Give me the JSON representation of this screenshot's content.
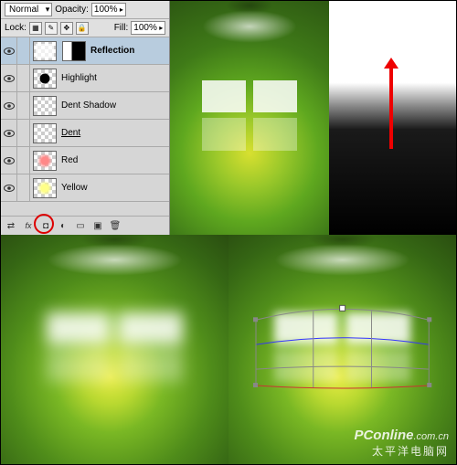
{
  "blend_mode": {
    "value": "Normal"
  },
  "opacity": {
    "label": "Opacity:",
    "value": "100%"
  },
  "fill": {
    "label": "Fill:",
    "value": "100%"
  },
  "lock": {
    "label": "Lock:"
  },
  "layers": [
    {
      "name": "Reflection",
      "selected": true,
      "bold": true,
      "underline": false,
      "mask": true
    },
    {
      "name": "Highlight",
      "selected": false,
      "bold": false,
      "underline": false,
      "mask": false
    },
    {
      "name": "Dent Shadow",
      "selected": false,
      "bold": false,
      "underline": false,
      "mask": false
    },
    {
      "name": "Dent",
      "selected": false,
      "bold": false,
      "underline": true,
      "mask": false
    },
    {
      "name": "Red",
      "selected": false,
      "bold": false,
      "underline": false,
      "mask": false
    },
    {
      "name": "Yellow",
      "selected": false,
      "bold": false,
      "underline": false,
      "mask": false
    }
  ],
  "footer_icons": {
    "link": "chain-icon",
    "fx": "fx",
    "mask": "mask-icon",
    "adjust": "adjust-icon",
    "group": "folder-icon",
    "new": "new-layer-icon",
    "delete": "trash-icon"
  },
  "watermark": {
    "main_brand": "PConline",
    "main_tld": ".com.cn",
    "sub": "太平洋电脑网"
  }
}
